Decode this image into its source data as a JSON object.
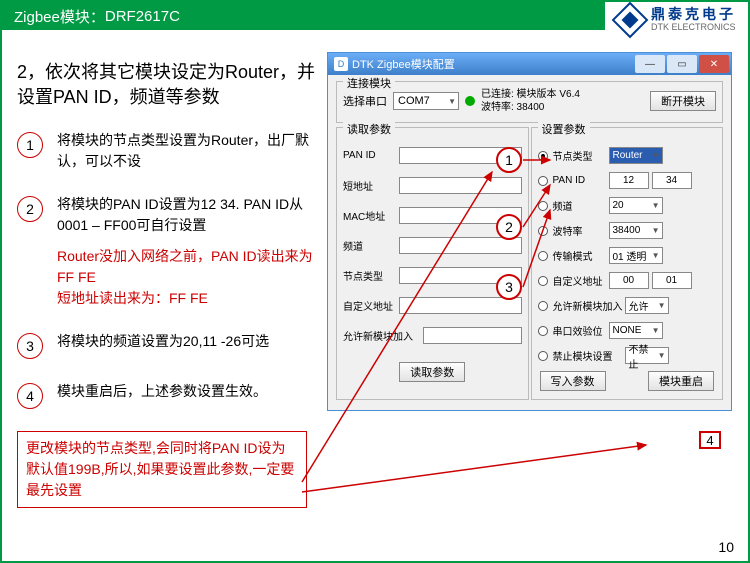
{
  "header": {
    "prefix": "Zigbee模块：",
    "model": "DRF2617C"
  },
  "logo": {
    "cn": "鼎泰克电子",
    "en": "DTK ELECTRONICS"
  },
  "main_instruction": "2，依次将其它模块设定为Router，并设置PAN ID，频道等参数",
  "steps": [
    {
      "num": "1",
      "text": "将模块的节点类型设置为Router，出厂默认，可以不设"
    },
    {
      "num": "2",
      "text": "将模块的PAN ID设置为12 34. PAN ID从 0001 – FF00可自行设置"
    },
    {
      "num": "3",
      "text": "将模块的频道设置为20,11 -26可选"
    },
    {
      "num": "4",
      "text": "模块重启后，上述参数设置生效。"
    }
  ],
  "red_note_line1": "Router没加入网络之前，PAN ID读出来为FF FE",
  "red_note_line2": "短地址读出来为：FF FE",
  "warning": "更改模块的节点类型,会同时将PAN ID设为默认值199B,所以,如果要设置此参数,一定要最先设置",
  "win": {
    "title": "DTK Zigbee模块配置",
    "icon_letter": "D",
    "group_connect": "连接模块",
    "port_label": "选择串口",
    "port_value": "COM7",
    "status_line1": "已连接: 模块版本 V6.4",
    "status_line2": "波特率: 38400",
    "btn_disconnect": "断开模块",
    "group_read": "读取参数",
    "read_rows": [
      "PAN ID",
      "短地址",
      "MAC地址",
      "频道",
      "节点类型",
      "自定义地址",
      "允许新模块加入"
    ],
    "btn_read": "读取参数",
    "group_set": "设置参数",
    "set": {
      "node_type_label": "节点类型",
      "node_type_value": "Router",
      "pan_id_label": "PAN ID",
      "pan_id_a": "12",
      "pan_id_b": "34",
      "channel_label": "频道",
      "channel_value": "20",
      "baud_label": "波特率",
      "baud_value": "38400",
      "tx_mode_label": "传输模式",
      "tx_mode_value": "01 透明",
      "custom_addr_label": "自定义地址",
      "custom_a": "00",
      "custom_b": "01",
      "allow_join_label": "允许新模块加入",
      "allow_join_value": "允许",
      "uart_check_label": "串口效验位",
      "uart_check_value": "NONE",
      "forbid_label": "禁止模块设置",
      "forbid_value": "不禁止"
    },
    "btn_write": "写入参数",
    "btn_restart": "模块重启"
  },
  "ann": {
    "c1": "1",
    "c2": "2",
    "c3": "3",
    "c4": "4"
  },
  "page_num": "10"
}
